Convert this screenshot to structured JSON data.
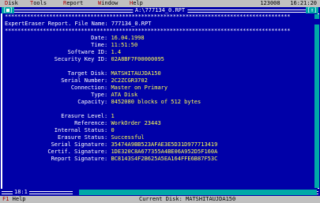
{
  "menu": {
    "items": [
      {
        "hotkey": "D",
        "rest": "isk"
      },
      {
        "hotkey": "T",
        "rest": "ools"
      },
      {
        "hotkey": "R",
        "rest": "eport"
      },
      {
        "hotkey": "W",
        "rest": "indow"
      },
      {
        "hotkey": "H",
        "rest": "elp"
      }
    ],
    "counter": "123008",
    "clock": "16:21:20"
  },
  "window": {
    "title": "A:\\777134_0.RPT",
    "close_glyph": "[■]",
    "max_glyph": "[↑]"
  },
  "report": {
    "stars": "******************************************************************************************",
    "header": "ExpertEraser Report. File Name: 777134_0.RPT",
    "fields_1": [
      {
        "label": "Date",
        "value": "16.04.1998"
      },
      {
        "label": "Time",
        "value": "11:51:50"
      },
      {
        "label": "Software ID",
        "value": "1.4"
      },
      {
        "label": "Security Key ID",
        "value": "02A8BF7F00000095"
      }
    ],
    "fields_2": [
      {
        "label": "Target Disk",
        "value": "MATSHITAUJDA150"
      },
      {
        "label": "Serial Number",
        "value": "2C2ZCGR3702"
      },
      {
        "label": "Connection",
        "value": "Master on Primary"
      },
      {
        "label": "Type",
        "value": "ATA Disk"
      },
      {
        "label": "Capacity",
        "value": "8452080 blocks of 512 bytes"
      }
    ],
    "fields_3": [
      {
        "label": "Erasure Level",
        "value": "1"
      },
      {
        "label": "Reference",
        "value": "WorkOrder 23443"
      },
      {
        "label": "Internal Status",
        "value": "0"
      },
      {
        "label": "Erasure Status",
        "value": "Successful"
      },
      {
        "label": "Serial Signature",
        "value": "35474A9BB523AFAE3E5D31D977713419"
      },
      {
        "label": "Certif. Signature",
        "value": "1DE320C8A677355A4BE06A952D5F160A"
      },
      {
        "label": "Report Signature",
        "value": "BC8143S4F2B625A5EA164FFE6B87F53C"
      }
    ]
  },
  "bottom": {
    "position": "18:1"
  },
  "status": {
    "help_key": "F1",
    "help_label": "Help",
    "current_disk": "Current Disk: MATSHITAUJDA150"
  }
}
